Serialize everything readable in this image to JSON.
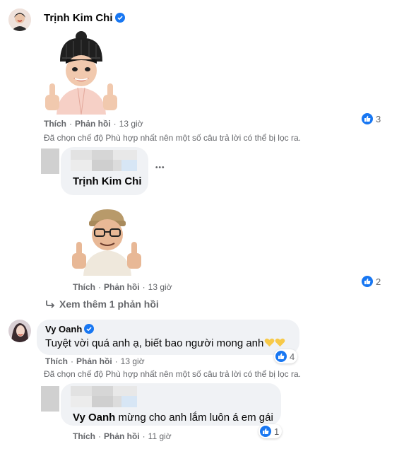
{
  "comment1": {
    "author": "Trịnh Kim Chi",
    "actions": {
      "like": "Thích",
      "reply": "Phản hồi",
      "time": "13 giờ"
    },
    "reactions": "3",
    "filter_note": "Đã chọn chế độ Phù hợp nhất nên một số câu trả lời có thể bị lọc ra."
  },
  "reply1": {
    "author": "Trịnh Kim Chi",
    "actions": {
      "like": "Thích",
      "reply": "Phản hồi",
      "time": "13 giờ"
    },
    "reactions": "2",
    "more_icon_label": "•••"
  },
  "see_more": {
    "label": "Xem thêm 1 phản hồi"
  },
  "comment2": {
    "author": "Vy Oanh",
    "text": "Tuyệt vời quá anh ạ, biết bao người mong anh",
    "actions": {
      "like": "Thích",
      "reply": "Phản hồi",
      "time": "13 giờ"
    },
    "reactions": "4",
    "filter_note": "Đã chọn chế độ Phù hợp nhất nên một số câu trả lời có thể bị lọc ra."
  },
  "reply2": {
    "mention": "Vy Oanh",
    "text": " mừng cho anh lắm luôn á em gái",
    "actions": {
      "like": "Thích",
      "reply": "Phản hồi",
      "time": "11 giờ"
    },
    "reactions": "1"
  },
  "colors": {
    "like_blue": "#1877f2",
    "meta_gray": "#65676b",
    "bubble": "#f0f2f5"
  }
}
